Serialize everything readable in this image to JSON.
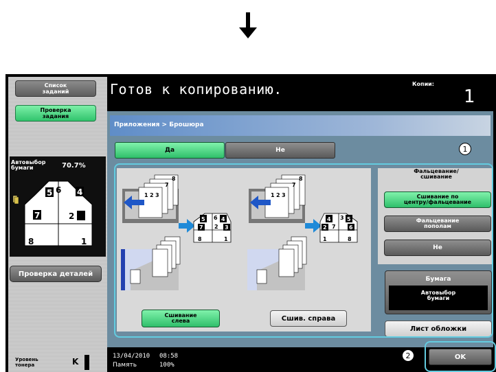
{
  "icons": {
    "down_arrow": "down-arrow-icon",
    "paper_stack": "paper-stack-icon",
    "toner": "toner-level-icon",
    "right_arrow": "right-arrow-icon",
    "left_arrow": "left-arrow-icon",
    "finisher": "finisher-icon"
  },
  "left_panel": {
    "job_list": "Список\nзаданий",
    "job_check": "Проверка\nзадания",
    "paper_auto": "Автовыбор\nбумаги",
    "zoom": "70.7%",
    "details": "Проверка деталей",
    "toner_label": "Уровень\nтонера",
    "toner_color": "K"
  },
  "header": {
    "status_message": "Готов к копированию.",
    "copies_label": "Копии:",
    "copies_value": "1"
  },
  "breadcrumb": "Приложения > Брошюра",
  "toggle": {
    "yes": "Да",
    "no": "Не"
  },
  "binding": {
    "left": "Сшивание\nслева",
    "right": "Сшив. справа"
  },
  "fold": {
    "label": "Фальцевание/\nсшивание",
    "center_stitch": "Сшивание по\nцентру/фальцевание",
    "half_fold": "Фальцевание\nпополам",
    "none": "Не"
  },
  "paper": {
    "title": "Бумага",
    "value": "Автовыбор\nбумаги"
  },
  "cover_sheet": "Лист обложки",
  "status_bar": {
    "date": "13/04/2010",
    "time": "08:58",
    "memory_label": "Память",
    "memory_value": "100%"
  },
  "ok": "OK",
  "callouts": {
    "one": "1",
    "two": "2"
  },
  "illustration": {
    "left_sheets": [
      "8",
      "7",
      "1",
      "2",
      "3"
    ],
    "left_result": [
      "5",
      "6",
      "4",
      "7",
      "2",
      "3",
      "8",
      "1"
    ],
    "right_sheets": [
      "8",
      "7",
      "1",
      "2",
      "3"
    ],
    "right_result": [
      "4",
      "3",
      "5",
      "2",
      "7",
      "6",
      "1",
      "8"
    ],
    "side_numbers": [
      "5",
      "6",
      "4",
      "7",
      "2",
      "3",
      "8",
      "1"
    ]
  },
  "colors": {
    "accent_green": "#2fbf6b",
    "outline_cyan": "#63cce0",
    "main_bg": "#6c8ca0"
  }
}
